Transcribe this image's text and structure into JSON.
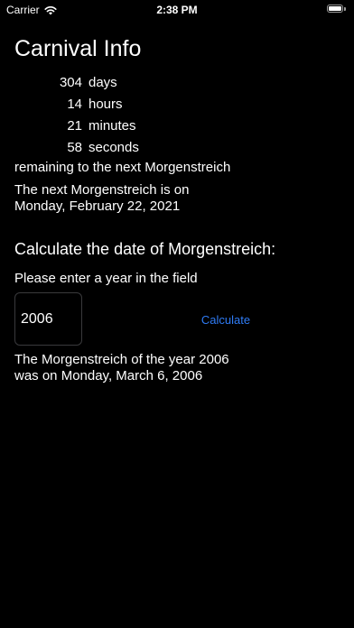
{
  "status_bar": {
    "carrier": "Carrier",
    "time": "2:38 PM"
  },
  "title": "Carnival Info",
  "countdown": [
    {
      "value": "304",
      "unit": "days"
    },
    {
      "value": "14",
      "unit": "hours"
    },
    {
      "value": "21",
      "unit": "minutes"
    },
    {
      "value": "58",
      "unit": "seconds"
    }
  ],
  "remaining_text": "remaining to the next Morgenstreich",
  "next_date": {
    "line1": "The next Morgenstreich is on",
    "line2": "Monday, February 22, 2021"
  },
  "calculator": {
    "title": "Calculate the date of Morgenstreich:",
    "prompt": "Please enter a year in the field",
    "year_value": "2006",
    "button_label": "Calculate",
    "result_line1": "The Morgenstreich of the year 2006",
    "result_line2": "was on Monday, March 6, 2006"
  },
  "colors": {
    "background": "#000000",
    "text": "#ffffff",
    "accent": "#2f7cf6"
  }
}
